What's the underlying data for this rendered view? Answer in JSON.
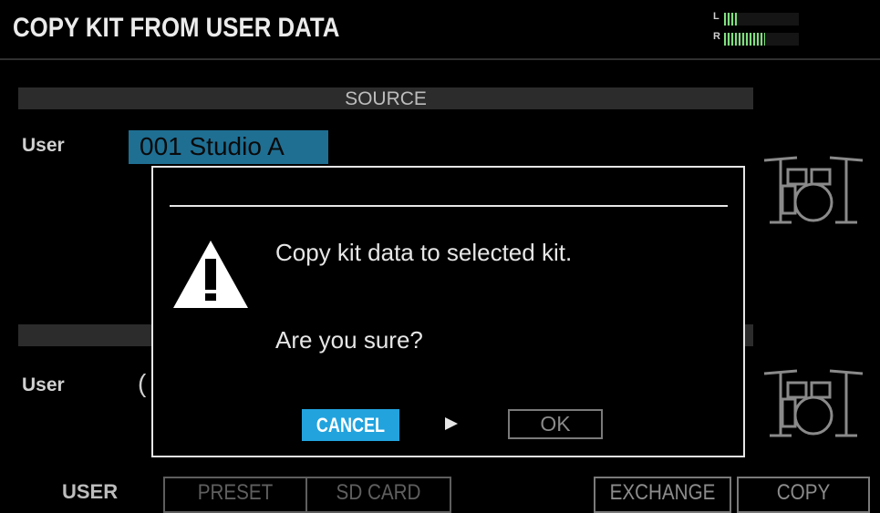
{
  "header": {
    "title": "COPY KIT FROM USER DATA"
  },
  "meter": {
    "left_label": "L",
    "right_label": "R",
    "left_level": 0.2,
    "right_level": 0.55
  },
  "source": {
    "section_label": "SOURCE",
    "row_label": "User",
    "kit_value": "001 Studio A"
  },
  "destination": {
    "row_label": "User",
    "kit_value_partial": "("
  },
  "dialog": {
    "message_line1": "Copy kit data to selected kit.",
    "message_line2": "Are you sure?",
    "cancel_label": "CANCEL",
    "ok_label": "OK"
  },
  "footer": {
    "user_label": "USER",
    "preset_label": "PRESET",
    "sd_card_label": "SD CARD",
    "exchange_label": "EXCHANGE",
    "copy_label": "COPY"
  },
  "colors": {
    "accent": "#22a3de",
    "selection": "#1f6f93",
    "meter_green": "#7fe07f"
  },
  "icons": [
    "warning-icon",
    "drum-kit-icon",
    "play-arrow-icon"
  ]
}
